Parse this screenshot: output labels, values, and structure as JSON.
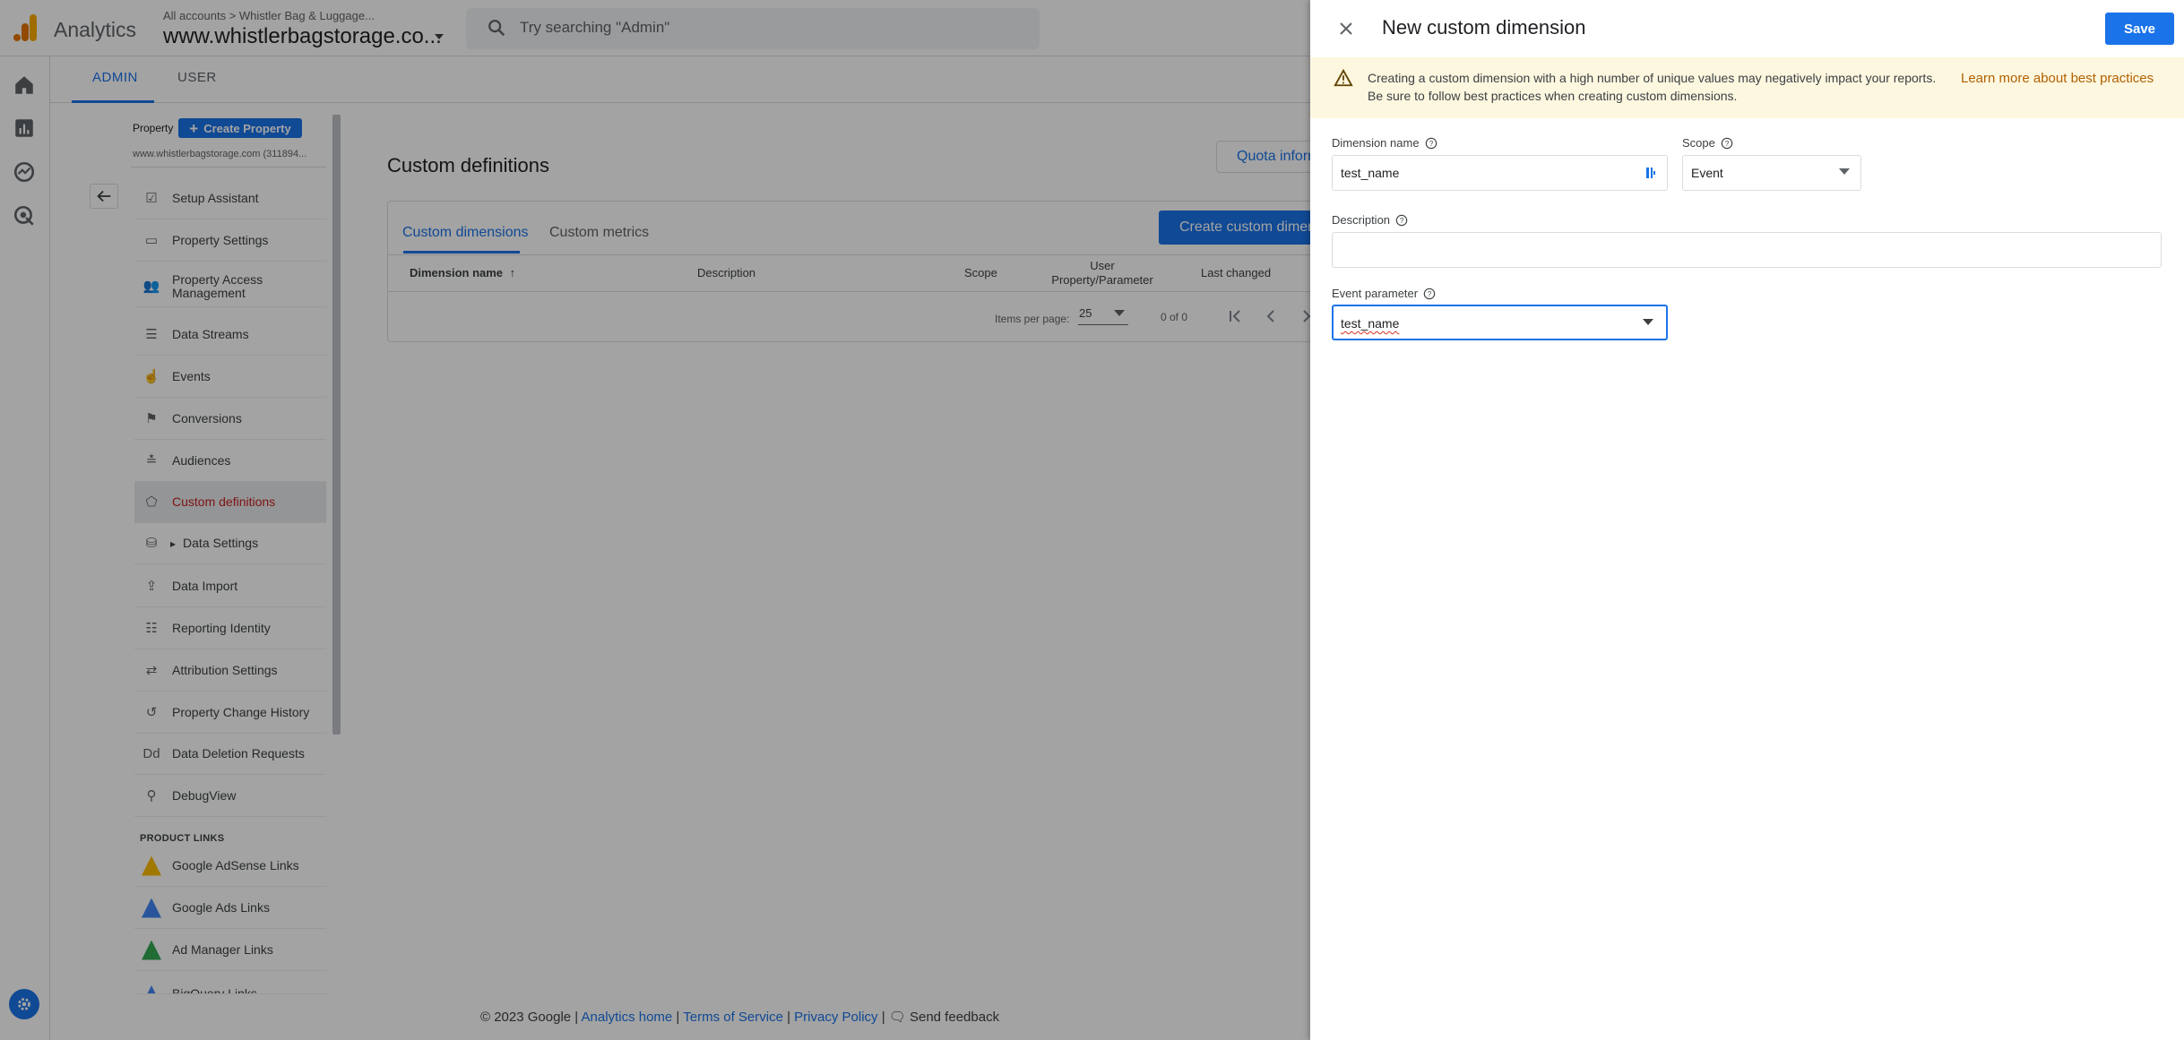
{
  "topbar": {
    "app_name": "Analytics",
    "breadcrumb": "All accounts > Whistler Bag & Luggage...",
    "property_name": "www.whistlerbagstorage.co...",
    "search_placeholder": "Try searching \"Admin\""
  },
  "admin_tabs": {
    "admin": "ADMIN",
    "user": "USER"
  },
  "nav": {
    "property_label": "Property",
    "create_property": "Create Property",
    "property_id": "www.whistlerbagstorage.com (311894...",
    "items": [
      {
        "label": "Setup Assistant",
        "icon": "checkbox-icon"
      },
      {
        "label": "Property Settings",
        "icon": "page-icon"
      },
      {
        "label": "Property Access Management",
        "icon": "people-icon"
      },
      {
        "label": "Data Streams",
        "icon": "streams-icon"
      },
      {
        "label": "Events",
        "icon": "touch-icon"
      },
      {
        "label": "Conversions",
        "icon": "flag-icon"
      },
      {
        "label": "Audiences",
        "icon": "audience-icon"
      },
      {
        "label": "Custom definitions",
        "icon": "shapes-icon"
      },
      {
        "label": "Data Settings",
        "icon": "database-icon"
      },
      {
        "label": "Data Import",
        "icon": "upload-icon"
      },
      {
        "label": "Reporting Identity",
        "icon": "identity-icon"
      },
      {
        "label": "Attribution Settings",
        "icon": "attribution-icon"
      },
      {
        "label": "Property Change History",
        "icon": "history-icon"
      },
      {
        "label": "Data Deletion Requests",
        "icon": "dd-icon"
      },
      {
        "label": "DebugView",
        "icon": "debug-icon"
      }
    ],
    "product_links_heading": "PRODUCT LINKS",
    "product_links": [
      {
        "label": "Google AdSense Links",
        "icon": "adsense-icon"
      },
      {
        "label": "Google Ads Links",
        "icon": "google-ads-icon"
      },
      {
        "label": "Ad Manager Links",
        "icon": "ad-manager-icon"
      },
      {
        "label": "BigQuery Links",
        "icon": "bigquery-icon"
      }
    ]
  },
  "main": {
    "title": "Custom definitions",
    "quota_button": "Quota information",
    "tabs": [
      "Custom dimensions",
      "Custom metrics"
    ],
    "create_button": "Create custom dimensions",
    "columns": [
      "Dimension name",
      "Description",
      "Scope",
      "User Property/Parameter",
      "Last changed"
    ],
    "items_per_page_label": "Items per page:",
    "items_per_page": "25",
    "page_range": "0 of 0"
  },
  "footer": {
    "copyright": "© 2023 Google |",
    "analytics_home": "Analytics home",
    "terms": "Terms of Service",
    "privacy": "Privacy Policy",
    "feedback": "Send feedback"
  },
  "drawer": {
    "title": "New custom dimension",
    "save": "Save",
    "warning": "Creating a custom dimension with a high number of unique values may negatively impact your reports. Be sure to follow best practices when creating custom dimensions.",
    "warning_link": "Learn more about best practices",
    "dimension_name_label": "Dimension name",
    "dimension_name_value": "test_name",
    "scope_label": "Scope",
    "scope_value": "Event",
    "description_label": "Description",
    "description_value": "",
    "event_parameter_label": "Event parameter",
    "event_parameter_value": "test_name"
  },
  "colors": {
    "accent": "#1a73e8",
    "active_nav_text": "#c5221f",
    "warning_bg": "#fef7e0",
    "warning_link": "#b06000"
  }
}
